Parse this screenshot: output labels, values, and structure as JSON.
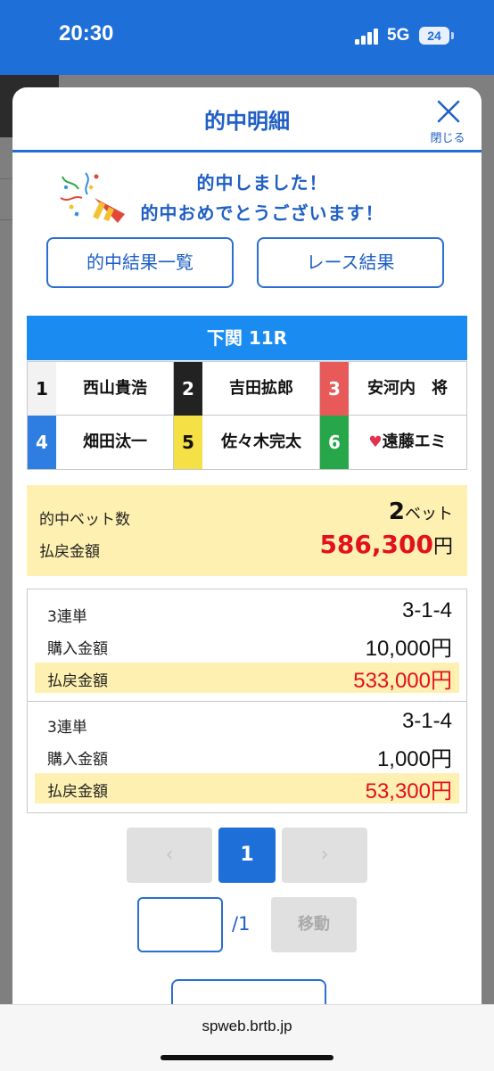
{
  "status_bar": {
    "time": "20:30",
    "network": "5G",
    "battery": "24"
  },
  "modal": {
    "title": "的中明細",
    "close_label": "閉じる",
    "congrats_line1": "的中しました！",
    "congrats_line2": "的中おめでとうございます！",
    "buttons": {
      "hit_results": "的中結果一覧",
      "race_results": "レース結果"
    }
  },
  "race": {
    "header": "下関 11R",
    "racers": [
      {
        "number": "1",
        "name": "西山貴浩",
        "color": "#f2f2f2",
        "text_color": "#111111"
      },
      {
        "number": "2",
        "name": "吉田拡郎",
        "color": "#222222",
        "text_color": "#ffffff"
      },
      {
        "number": "3",
        "name": "安河内　将",
        "color": "#e85a5a",
        "text_color": "#ffffff"
      },
      {
        "number": "4",
        "name": "畑田汰一",
        "color": "#2e7de0",
        "text_color": "#ffffff"
      },
      {
        "number": "5",
        "name": "佐々木完太",
        "color": "#f5e046",
        "text_color": "#111111"
      },
      {
        "number": "6",
        "name": "遠藤エミ",
        "color": "#27a64a",
        "text_color": "#ffffff",
        "heart": "♥"
      }
    ]
  },
  "summary": {
    "bets_label": "的中ベット数",
    "bets_count": "2",
    "bets_unit": "ベット",
    "payout_label": "払戻金額",
    "payout_value": "586,300",
    "payout_unit": "円"
  },
  "bets": [
    {
      "type": "3連単",
      "combo": "3-1-4",
      "purchase_label": "購入金額",
      "purchase": "10,000円",
      "payout_label": "払戻金額",
      "payout": "533,000円"
    },
    {
      "type": "3連単",
      "combo": "3-1-4",
      "purchase_label": "購入金額",
      "purchase": "1,000円",
      "payout_label": "払戻金額",
      "payout": "53,300円"
    }
  ],
  "pagination": {
    "prev": "‹",
    "current": "1",
    "next": "›",
    "input_value": "",
    "total": "/1",
    "go_label": "移動"
  },
  "browser": {
    "url": "spweb.brtb.jp"
  },
  "colors": {
    "brand_blue": "#1f6fd8",
    "highlight_yellow": "#fdf0b0",
    "payout_red": "#e3101d"
  }
}
